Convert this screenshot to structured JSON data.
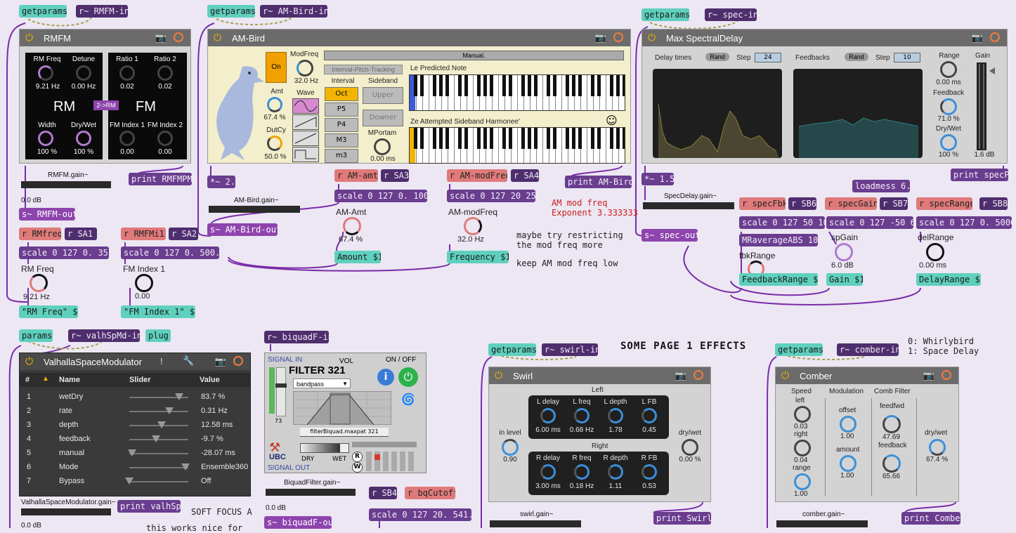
{
  "rmfm": {
    "getparams": "getparams",
    "recv": "r~ RMFM-in",
    "title": "RMFM",
    "rm_freq_label": "RM Freq",
    "rm_freq_value": "9.21 Hz",
    "detune_label": "Detune",
    "detune_value": "0.00 Hz",
    "ratio1_label": "Ratio 1",
    "ratio1_value": "0.02",
    "ratio2_label": "Ratio 2",
    "ratio2_value": "0.02",
    "rm_label": "RM",
    "fm_label": "FM",
    "switch_label": "2->RM",
    "width_label": "Width",
    "width_value": "100 %",
    "drywet_label": "Dry/Wet",
    "drywet_value": "100 %",
    "fmindex1_label": "FM Index 1",
    "fmindex1_value": "0.00",
    "fmindex2_label": "FM Index 2",
    "fmindex2_value": "0.00",
    "print": "print RMFMPM",
    "gain_label": "RMFM.gain~",
    "gain_db": "0.0 dB",
    "send": "s~ RMFM-out",
    "r1": "r RMfreq",
    "sa1": "r SA1",
    "r2": "r RMFMi1",
    "sa2": "r SA2",
    "scale1": "scale 0 127 0. 35.",
    "scale2": "scale 0 127 0. 500.",
    "dial1_label": "RM Freq",
    "dial1_value": "9.21 Hz",
    "dial2_label": "FM Index 1",
    "dial2_value": "0.00",
    "msg1": "\"RM Freq\" $1",
    "msg2": "\"FM Index 1\" $1"
  },
  "ambird": {
    "getparams": "getparams",
    "recv": "r~ AM-Bird-in",
    "title": "AM-Bird",
    "on": "On",
    "modfreq_label": "ModFreq",
    "modfreq_value": "32.0 Hz",
    "amt_label": "Amt",
    "amt_value": "67.4 %",
    "dutcy_label": "DutCy",
    "dutcy_value": "50.0 %",
    "wave_label": "Wave",
    "manual": "Manual.",
    "ipt": "Interval-Pitch-Tracking",
    "interval_label": "Interval",
    "sideband_label": "Sideband",
    "intervals": [
      "Oct",
      "P5",
      "P4",
      "M3",
      "m3"
    ],
    "upper": "Upper",
    "downer": "Downer",
    "mportam_label": "MPortam",
    "mportam_value": "0.00 ms",
    "predicted": "Le Predicted Note",
    "attempted": "Ze Attempted Sideband Harmonee'",
    "mul": "*~ 2.",
    "gain_label": "AM-Bird.gain~",
    "send": "s~ AM-Bird-out",
    "print": "print AM-Bird",
    "r_amt": "r AM-amt",
    "sa3": "r SA3",
    "scale_amt": "scale 0 127 0. 100.",
    "amt_dial_label": "AM-Amt",
    "amt_dial_value": "67.4 %",
    "amount_msg": "Amount $1",
    "r_modfreq": "r AM-modFreq",
    "sa4": "r SA4",
    "scale_mod": "scale 0 127 20 250",
    "mod_dial_label": "AM-modFreq",
    "mod_dial_value": "32.0 Hz",
    "freq_msg": "Frequency $1",
    "note_red": "AM mod freq\nExponent 3.333333",
    "note1": "maybe try restricting\nthe mod freq more",
    "note2": "keep AM mod freq low"
  },
  "spectral": {
    "getparams": "getparams",
    "recv": "r~ spec-in",
    "title": "Max SpectralDelay",
    "delay_label": "Delay times",
    "rand1": "Rand",
    "step1_label": "Step",
    "step1_value": "24",
    "fb_label": "Feedbacks",
    "rand2": "Rand",
    "step2_label": "Step",
    "step2_value": "10",
    "range_label": "Range",
    "range_value": "0.00 ms",
    "feedback_label": "Feedback",
    "feedback_value": "71.0 %",
    "drywet_label": "Dry/Wet",
    "drywet_value": "100 %",
    "gain_label": "Gain",
    "gain_value": "1.6 dB",
    "mul": "*~ 1.5",
    "gain_obj_label": "SpecDelay.gain~",
    "send": "s~ spec-out",
    "print": "print specP",
    "r_fbk": "r specFbk",
    "sb6": "r SB6",
    "r_gain": "r specGain",
    "sb7": "r SB7",
    "r_range": "r specRange",
    "sb8": "r SB8",
    "loadmess": "loadmess 6.",
    "scale_fbk": "scale 0 127 50 100",
    "scale_gain": "scale 0 127 -50 6.",
    "scale_range": "scale 0 127 0. 5000.",
    "mravg": "MRaverageABS 100",
    "fbk_dial_label": "fbkRange",
    "spgain_label": "spGain",
    "spgain_value": "6.0 dB",
    "delrange_label": "delRange",
    "delrange_value": "0.00 ms",
    "msg_fb": "FeedbackRange $1",
    "msg_gain": "Gain $1",
    "msg_delay": "DelayRange $1"
  },
  "valhalla": {
    "params": "params",
    "recv": "r~ valhSpMd-in",
    "plug": "plug",
    "title": "ValhallaSpaceModulator",
    "columns": [
      "#",
      "Name",
      "Slider",
      "Value"
    ],
    "rows": [
      {
        "n": "1",
        "name": "wetDry",
        "value": "83.7 %",
        "pos": 0.84
      },
      {
        "n": "2",
        "name": "rate",
        "value": "0.31 Hz",
        "pos": 0.68
      },
      {
        "n": "3",
        "name": "depth",
        "value": "12.58 ms",
        "pos": 0.55
      },
      {
        "n": "4",
        "name": "feedback",
        "value": "-9.7 %",
        "pos": 0.45
      },
      {
        "n": "5",
        "name": "manual",
        "value": "-28.07 ms",
        "pos": 0.05
      },
      {
        "n": "6",
        "name": "Mode",
        "value": "Ensemble360",
        "pos": 0.95
      },
      {
        "n": "7",
        "name": "Bypass",
        "value": "Off",
        "pos": 0.0
      }
    ],
    "gain_label": "ValhallaSpaceModulator.gain~",
    "gain_db": "0.0 dB",
    "print": "print valhSpM",
    "note1": "SOFT FOCUS A",
    "note2": "this works nice for"
  },
  "biquad": {
    "recv": "r~ biquadF-in",
    "signal_in": "SIGNAL IN",
    "filter_title": "FILTER 321",
    "vol": "VOL",
    "onoff": "ON / OFF",
    "mode": "bandpass",
    "vol_value": "73",
    "patch": "filterBiquad.maxpat 321",
    "dry": "DRY",
    "wet": "WET",
    "ubc": "UBC",
    "signal_out": "SIGNAL OUT",
    "gain_label": "BiquadFilter.gain~",
    "gain_db": "0.0 dB",
    "send": "s~ biquadF-out",
    "sb4": "r SB4",
    "r_cut": "r bqCutoff",
    "scale": "scale 0 127 20. 541."
  },
  "swirl": {
    "getparams": "getparams",
    "recv": "r~ swirl-in",
    "title": "Swirl",
    "left": "Left",
    "right": "Right",
    "in_level_label": "in level",
    "in_level_value": "0.90",
    "drywet_label": "dry/wet",
    "drywet_value": "0.00 %",
    "l_params": [
      {
        "label": "L delay",
        "value": "6.00 ms"
      },
      {
        "label": "L freq",
        "value": "0.68 Hz"
      },
      {
        "label": "L depth",
        "value": "1.78"
      },
      {
        "label": "L FB",
        "value": "0.45"
      }
    ],
    "r_params": [
      {
        "label": "R delay",
        "value": "3.00 ms"
      },
      {
        "label": "R freq",
        "value": "0.18 Hz"
      },
      {
        "label": "R depth",
        "value": "1.11"
      },
      {
        "label": "R FB",
        "value": "0.53"
      }
    ],
    "gain_label": "swirl.gain~",
    "print": "print Swirl"
  },
  "comber": {
    "getparams": "getparams",
    "recv": "r~ comber-in",
    "title": "Comber",
    "speed": "Speed",
    "modulation": "Modulation",
    "comb": "Comb Filter",
    "left_label": "left",
    "left_value": "0.03",
    "right_label": "right",
    "right_value": "0.04",
    "range_label": "range",
    "range_value": "1.00",
    "offset_label": "offset",
    "offset_value": "1.00",
    "amount_label": "amount",
    "amount_value": "1.00",
    "feedfwd_label": "feedfwd",
    "feedfwd_value": "47.69",
    "feedback_label": "feedback",
    "feedback_value": "65.66",
    "drywet_label": "dry/wet",
    "drywet_value": "67.4 %",
    "gain_label": "comber.gain~",
    "print": "print Comber"
  },
  "page_title": "SOME PAGE 1 EFFECTS",
  "legend": "0: Whirlybird\n1: Space Delay"
}
